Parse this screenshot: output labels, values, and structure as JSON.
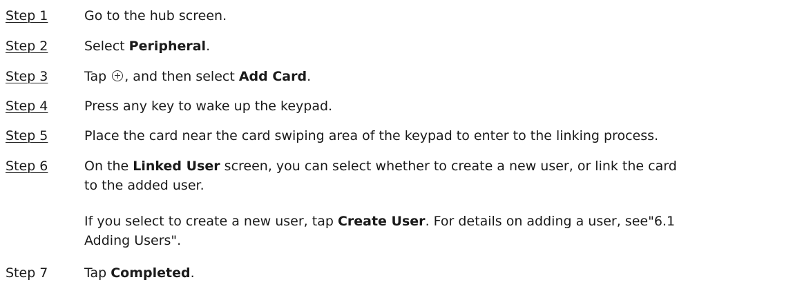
{
  "steps": [
    {
      "label": "Step 1",
      "parts": [
        {
          "t": "Go to the hub screen."
        }
      ]
    },
    {
      "label": "Step 2",
      "parts": [
        {
          "t": "Select "
        },
        {
          "b": "Peripheral"
        },
        {
          "t": "."
        }
      ]
    },
    {
      "label": "Step 3",
      "parts": [
        {
          "t": "Tap "
        },
        {
          "icon": "plus-circle-icon"
        },
        {
          "t": ", and then select "
        },
        {
          "b": "Add Card"
        },
        {
          "t": "."
        }
      ]
    },
    {
      "label": "Step 4",
      "parts": [
        {
          "t": "Press any key to wake up the keypad."
        }
      ]
    },
    {
      "label": "Step 5",
      "parts": [
        {
          "t": "Place the card near the card swiping area of the keypad to enter to the linking process."
        }
      ]
    },
    {
      "label": "Step 6",
      "parts": [
        {
          "t": "On the "
        },
        {
          "b": "Linked User"
        },
        {
          "t": "  screen, you can select whether to create a new user, or link the card"
        }
      ]
    },
    {
      "label": "Step 7",
      "parts": [
        {
          "t": "Tap "
        },
        {
          "b": "Completed"
        },
        {
          "t": "."
        }
      ]
    }
  ],
  "step6_continuation": "to the added user.",
  "step6_note": {
    "line1_pre": "If you select to create a new user, tap ",
    "line1_bold": "Create User",
    "line1_post": ". For details on adding a user, see\"6.1",
    "line2": "Adding Users\"."
  }
}
